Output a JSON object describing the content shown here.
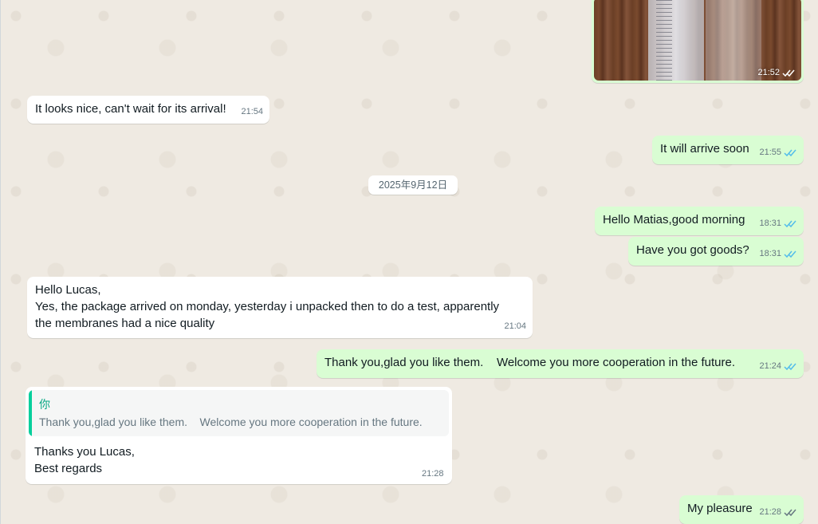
{
  "messages": {
    "image_time": "21:52",
    "m1": {
      "text": "It looks nice, can't wait for its arrival!",
      "time": "21:54"
    },
    "m2": {
      "text": "It will arrive soon",
      "time": "21:55"
    },
    "date_separator": "2025年9月12日",
    "m3": {
      "text": "Hello Matias,good morning",
      "time": "18:31"
    },
    "m4": {
      "text": "Have you got goods?",
      "time": "18:31"
    },
    "m5": {
      "line1": "Hello Lucas,",
      "line2": "Yes, the package arrived on monday, yesterday i unpacked then to do a test, apparently",
      "line3": "the membranes had a nice quality",
      "time": "21:04"
    },
    "m6": {
      "text": "Thank you,glad you like them.    Welcome you more cooperation in the future.",
      "time": "21:24"
    },
    "m7": {
      "quote_author": "你",
      "quote_text": "Thank you,glad you like them.    Welcome you more cooperation in the future.",
      "line1": "Thanks you Lucas,",
      "line2": "Best regards",
      "time": "21:28"
    },
    "m8": {
      "text": "My pleasure",
      "time": "21:28"
    }
  },
  "colors": {
    "incoming_bubble": "#ffffff",
    "outgoing_bubble": "#d9fdd3",
    "read_ticks": "#53bdeb",
    "quote_accent": "#06cf9c",
    "background": "#efeae2"
  },
  "icons": [
    "double-check-read-icon",
    "double-check-delivered-icon"
  ]
}
